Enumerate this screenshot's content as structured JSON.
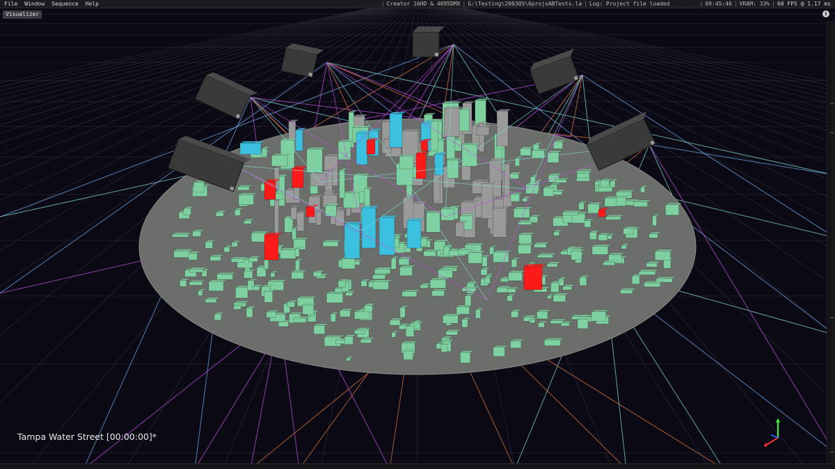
{
  "menu": {
    "items": [
      "File",
      "Window",
      "Sequence",
      "Help"
    ]
  },
  "status": {
    "device": "Creator 16HD & 4095DMX",
    "project_path": "G:\\Testing\\200305\\6projsABTests.la",
    "log": "Log: Project file loaded",
    "clock": "09:45:46",
    "vram": "VRAM: 33%",
    "fps": "60 FPS @ 1.17 ms"
  },
  "visualizer": {
    "tab_label": "Visualizer",
    "info_icon": "info-icon"
  },
  "scene": {
    "caption": "Tampa Water Street [00:00:00]*",
    "projector_count": 6,
    "colors": {
      "background": "#0b0a14",
      "grid": "#3a3c4e",
      "ground_disc": "#6c6e6b",
      "building_green": "#7fd0a0",
      "building_gray": "#9a9a9a",
      "building_blue": "#3cc0e0",
      "building_red": "#ff1a1a",
      "beam_cyan": "#7fd8d0",
      "beam_orange": "#e07840",
      "beam_magenta": "#c050e0",
      "beam_blue": "#70a8e8",
      "axis_x": "#ff3030",
      "axis_y": "#30ff30",
      "axis_z": "#3060ff"
    }
  }
}
